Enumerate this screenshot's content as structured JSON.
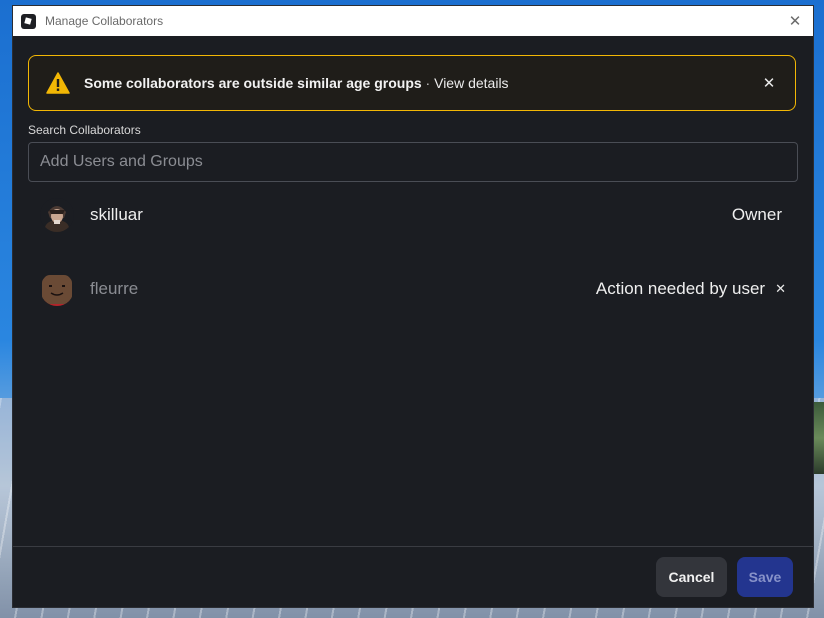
{
  "window": {
    "title": "Manage Collaborators"
  },
  "banner": {
    "message": "Some collaborators are outside similar age groups",
    "separator": "·",
    "link": "View details",
    "accent_color": "#f2b705",
    "icon": "warning-icon"
  },
  "search": {
    "label": "Search Collaborators",
    "placeholder": "Add Users and Groups",
    "value": ""
  },
  "collaborators": [
    {
      "name": "skilluar",
      "role": "Owner",
      "dimmed": false
    },
    {
      "name": "fleurre",
      "role": "Action needed by user",
      "dimmed": true,
      "removable": true
    }
  ],
  "footer": {
    "cancel_label": "Cancel",
    "save_label": "Save",
    "save_color": "#23358f"
  }
}
